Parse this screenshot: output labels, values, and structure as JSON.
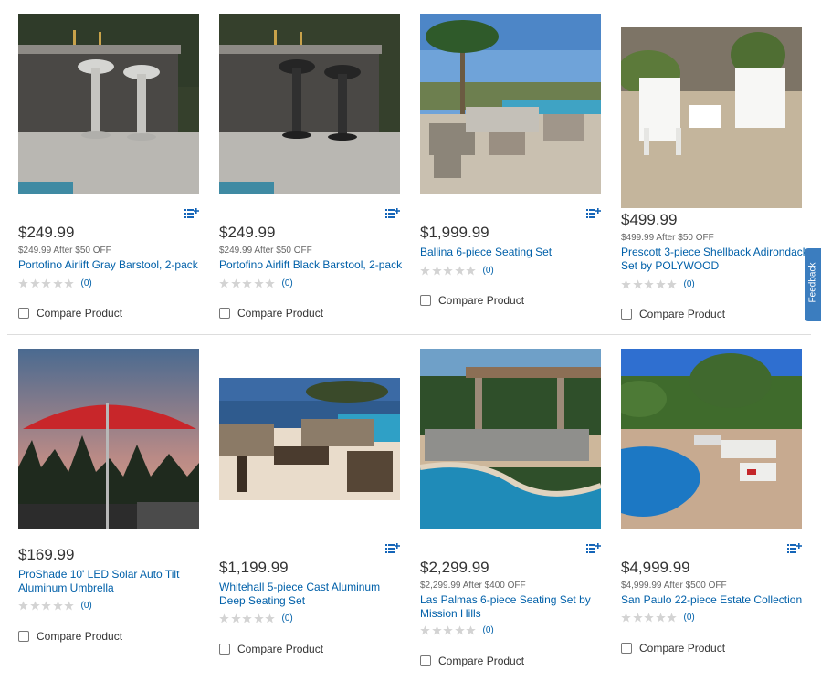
{
  "products": [
    {
      "price": "$249.99",
      "sub": "$249.99 After $50 OFF",
      "name": "Portofino Airlift Gray Barstool, 2-pack",
      "reviews": "(0)",
      "compare": "Compare Product"
    },
    {
      "price": "$249.99",
      "sub": "$249.99 After $50 OFF",
      "name": "Portofino Airlift Black Barstool, 2-pack",
      "reviews": "(0)",
      "compare": "Compare Product"
    },
    {
      "price": "$1,999.99",
      "sub": "",
      "name": "Ballina 6-piece Seating Set",
      "reviews": "(0)",
      "compare": "Compare Product"
    },
    {
      "price": "$499.99",
      "sub": "$499.99 After $50 OFF",
      "name": "Prescott 3-piece Shellback Adirondack Set by POLYWOOD",
      "reviews": "(0)",
      "compare": "Compare Product"
    },
    {
      "price": "$169.99",
      "sub": "",
      "name": "ProShade 10' LED Solar Auto Tilt Aluminum Umbrella",
      "reviews": "(0)",
      "compare": "Compare Product"
    },
    {
      "price": "$1,199.99",
      "sub": "",
      "name": "Whitehall 5-piece Cast Aluminum Deep Seating Set",
      "reviews": "(0)",
      "compare": "Compare Product"
    },
    {
      "price": "$2,299.99",
      "sub": "$2,299.99 After $400 OFF",
      "name": "Las Palmas 6-piece Seating Set by Mission Hills",
      "reviews": "(0)",
      "compare": "Compare Product"
    },
    {
      "price": "$4,999.99",
      "sub": "$4,999.99 After $500 OFF",
      "name": "San Paulo 22-piece Estate Collection",
      "reviews": "(0)",
      "compare": "Compare Product"
    }
  ],
  "feedback_label": "Feedback",
  "colors": {
    "link": "#0060a9",
    "feedback": "#3b7dbf",
    "star_empty": "#d3d3d3"
  }
}
